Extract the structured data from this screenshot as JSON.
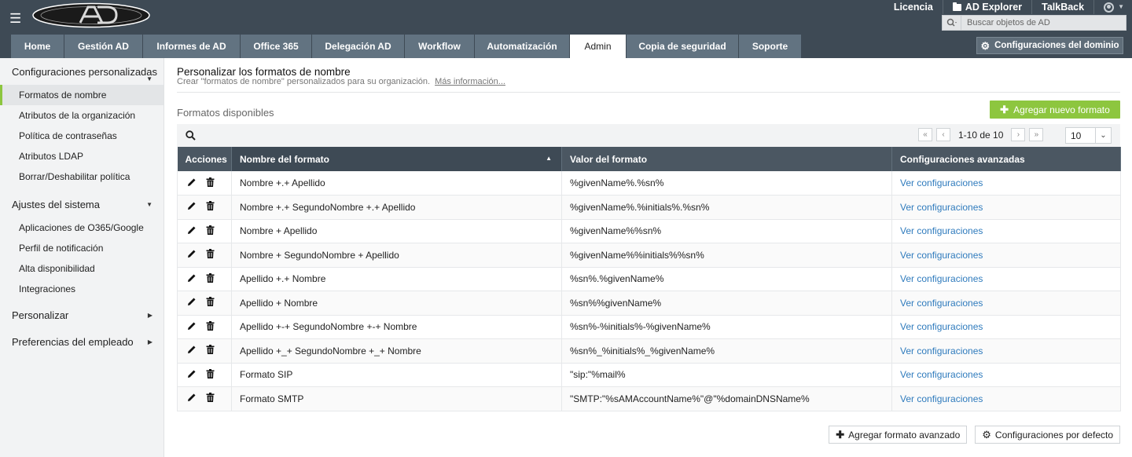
{
  "header": {
    "menu_icon": "hamburger-icon",
    "logo_icon": "ad-logo",
    "links": [
      {
        "label": "Licencia",
        "icon": ""
      },
      {
        "label": "AD Explorer",
        "icon": "folder-icon"
      },
      {
        "label": "TalkBack",
        "icon": ""
      }
    ],
    "user_icon": "user-icon",
    "search_placeholder": "Buscar objetos de AD",
    "domain_settings_label": "Configuraciones del dominio"
  },
  "tabs": [
    {
      "label": "Home",
      "active": false
    },
    {
      "label": "Gestión AD",
      "active": false
    },
    {
      "label": "Informes de AD",
      "active": false
    },
    {
      "label": "Office 365",
      "active": false
    },
    {
      "label": "Delegación AD",
      "active": false
    },
    {
      "label": "Workflow",
      "active": false
    },
    {
      "label": "Automatización",
      "active": false
    },
    {
      "label": "Admin",
      "active": true
    },
    {
      "label": "Copia de seguridad",
      "active": false
    },
    {
      "label": "Soporte",
      "active": false
    }
  ],
  "sidebar": {
    "sections": [
      {
        "title": "Configuraciones personalizadas",
        "expanded": true,
        "items": [
          "Formatos de nombre",
          "Atributos de la organización",
          "Política de contraseñas",
          "Atributos LDAP",
          "Borrar/Deshabilitar política"
        ]
      },
      {
        "title": "Ajustes del sistema",
        "expanded": true,
        "items": [
          "Aplicaciones de O365/Google",
          "Perfil de notificación",
          "Alta disponibilidad",
          "Integraciones"
        ]
      },
      {
        "title": "Personalizar",
        "expanded": false,
        "items": []
      },
      {
        "title": "Preferencias del empleado",
        "expanded": false,
        "items": []
      }
    ],
    "active_item": "Formatos de nombre"
  },
  "main": {
    "title": "Personalizar los formatos de nombre",
    "subtitle": "Crear \"formatos de nombre\" personalizados para su organización.",
    "more_info": "Más información...",
    "section_title": "Formatos disponibles",
    "add_button": "Agregar nuevo formato",
    "pager": {
      "info": "1-10 de 10",
      "page_size": "10"
    },
    "table": {
      "headers": [
        "Acciones",
        "Nombre del formato",
        "Valor del formato",
        "Configuraciones avanzadas"
      ],
      "rows": [
        {
          "name": "Nombre +.+ Apellido",
          "value": "%givenName%.%sn%",
          "link": "Ver configuraciones"
        },
        {
          "name": "Nombre +.+ SegundoNombre +.+ Apellido",
          "value": "%givenName%.%initials%.%sn%",
          "link": "Ver configuraciones"
        },
        {
          "name": "Nombre + Apellido",
          "value": "%givenName%%sn%",
          "link": "Ver configuraciones"
        },
        {
          "name": "Nombre + SegundoNombre + Apellido",
          "value": "%givenName%%initials%%sn%",
          "link": "Ver configuraciones"
        },
        {
          "name": "Apellido +.+ Nombre",
          "value": "%sn%.%givenName%",
          "link": "Ver configuraciones"
        },
        {
          "name": "Apellido + Nombre",
          "value": "%sn%%givenName%",
          "link": "Ver configuraciones"
        },
        {
          "name": "Apellido +-+ SegundoNombre +-+ Nombre",
          "value": "%sn%-%initials%-%givenName%",
          "link": "Ver configuraciones"
        },
        {
          "name": "Apellido +_+ SegundoNombre +_+ Nombre",
          "value": "%sn%_%initials%_%givenName%",
          "link": "Ver configuraciones"
        },
        {
          "name": "Formato SIP",
          "value": "\"sip:\"%mail%",
          "link": "Ver configuraciones"
        },
        {
          "name": "Formato SMTP",
          "value": "\"SMTP:\"%sAMAccountName%\"@\"%domainDNSName%",
          "link": "Ver configuraciones"
        }
      ]
    },
    "advanced_button": "Agregar formato avanzado",
    "defaults_button": "Configuraciones por defecto"
  },
  "colors": {
    "header": "#3e4a55",
    "tab": "#627381",
    "accent_green": "#8dc63f",
    "link": "#2f7bbd"
  }
}
